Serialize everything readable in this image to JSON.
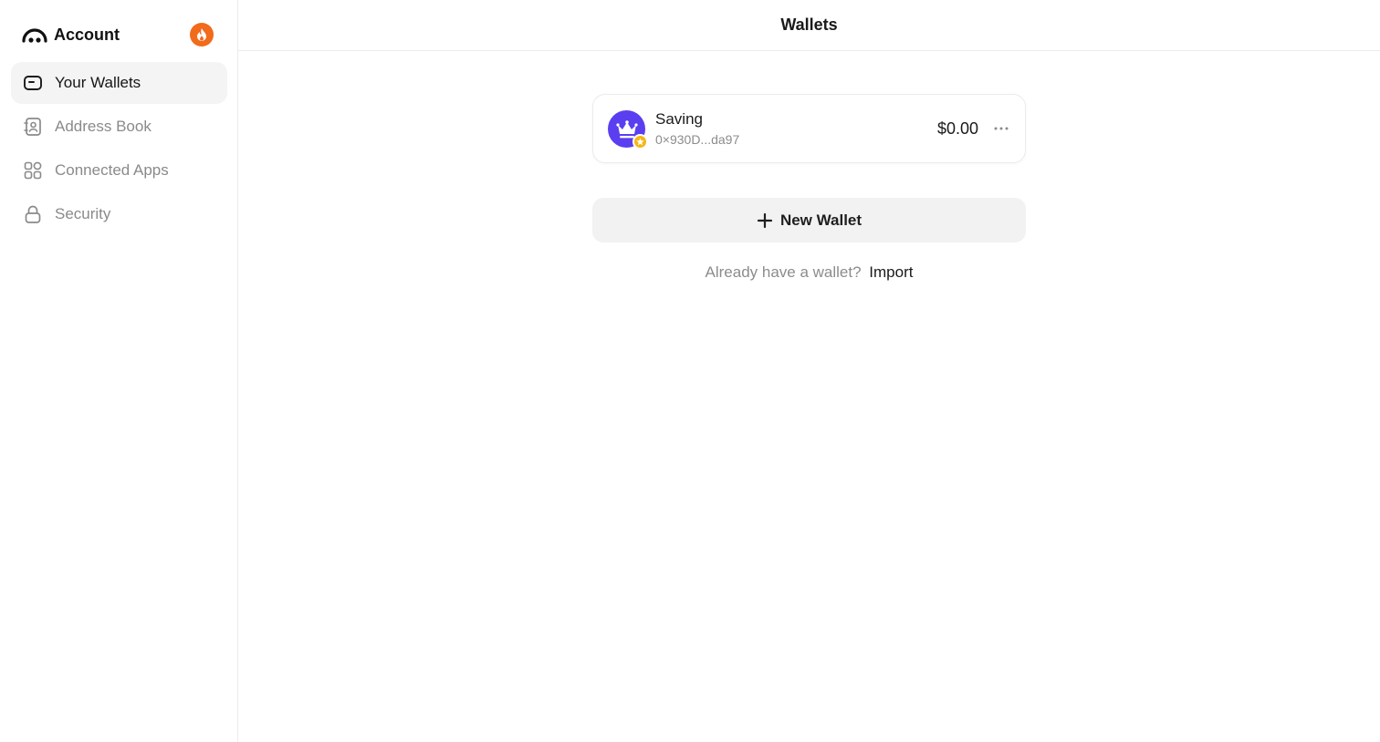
{
  "sidebar": {
    "title": "Account",
    "items": [
      {
        "label": "Your Wallets",
        "icon": "wallet-icon",
        "active": true
      },
      {
        "label": "Address Book",
        "icon": "contact-book-icon",
        "active": false
      },
      {
        "label": "Connected Apps",
        "icon": "apps-grid-icon",
        "active": false
      },
      {
        "label": "Security",
        "icon": "lock-icon",
        "active": false
      }
    ]
  },
  "header": {
    "title": "Wallets"
  },
  "wallet": {
    "name": "Saving",
    "address": "0×930D...da97",
    "balance": "$0.00"
  },
  "actions": {
    "new_wallet_label": "New Wallet",
    "import_prompt": "Already have a wallet?",
    "import_label": "Import"
  },
  "colors": {
    "accent_orange": "#f26a1b",
    "avatar_purple": "#5a3ff0",
    "star_yellow": "#f5b715",
    "active_bg": "#f4f4f5"
  }
}
